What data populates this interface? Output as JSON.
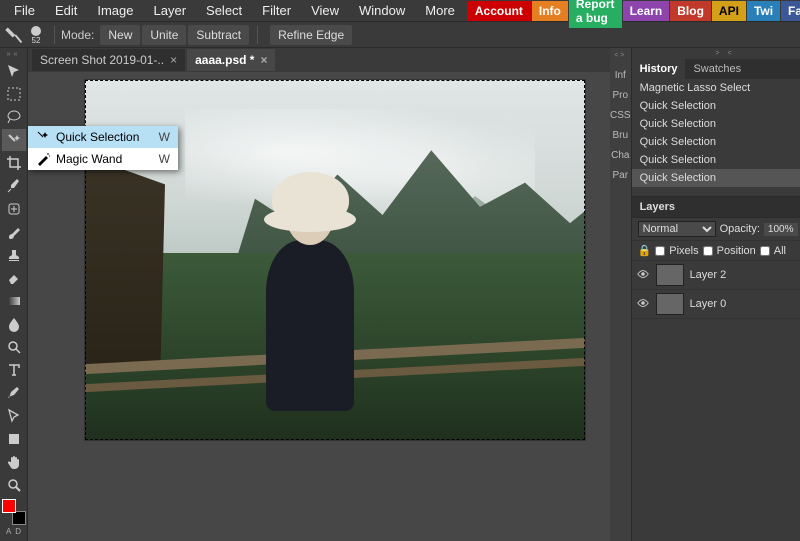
{
  "menubar": {
    "items": [
      "File",
      "Edit",
      "Image",
      "Layer",
      "Select",
      "Filter",
      "View",
      "Window",
      "More"
    ],
    "account": "Account",
    "right": [
      {
        "label": "Info",
        "cls": "info"
      },
      {
        "label": "Report a bug",
        "cls": "report"
      },
      {
        "label": "Learn",
        "cls": "learn"
      },
      {
        "label": "Blog",
        "cls": "blog"
      },
      {
        "label": "API",
        "cls": "api"
      },
      {
        "label": "Twi",
        "cls": "twi"
      },
      {
        "label": "Facebook",
        "cls": "fb"
      }
    ]
  },
  "optionbar": {
    "brush_size": "52",
    "mode_label": "Mode:",
    "modes": [
      "New",
      "Unite",
      "Subtract"
    ],
    "refine": "Refine Edge"
  },
  "tabs": [
    {
      "label": "Screen Shot 2019-01-..",
      "modified": false,
      "active": false
    },
    {
      "label": "aaaa.psd",
      "modified": true,
      "active": true
    }
  ],
  "flyout": {
    "items": [
      {
        "icon": "wand",
        "label": "Quick Selection",
        "key": "W",
        "selected": true
      },
      {
        "icon": "magic",
        "label": "Magic Wand",
        "key": "W",
        "selected": false
      }
    ]
  },
  "mini_panels": [
    "Inf",
    "Pro",
    "CSS",
    "Bru",
    "Cha",
    "Par"
  ],
  "history": {
    "tabs": [
      "History",
      "Swatches"
    ],
    "active_tab": 0,
    "items": [
      "Magnetic Lasso Select",
      "Quick Selection",
      "Quick Selection",
      "Quick Selection",
      "Quick Selection",
      "Quick Selection"
    ],
    "active_index": 5
  },
  "layers": {
    "title": "Layers",
    "blend": "Normal",
    "opacity_label": "Opacity:",
    "opacity_value": "100%",
    "locks": {
      "pixels": "Pixels",
      "position": "Position",
      "all": "All"
    },
    "layers": [
      {
        "name": "Layer 2",
        "visible": true,
        "checker": true
      },
      {
        "name": "Layer 0",
        "visible": true,
        "checker": false
      }
    ]
  },
  "swatch_indicator": [
    "A",
    "D"
  ]
}
